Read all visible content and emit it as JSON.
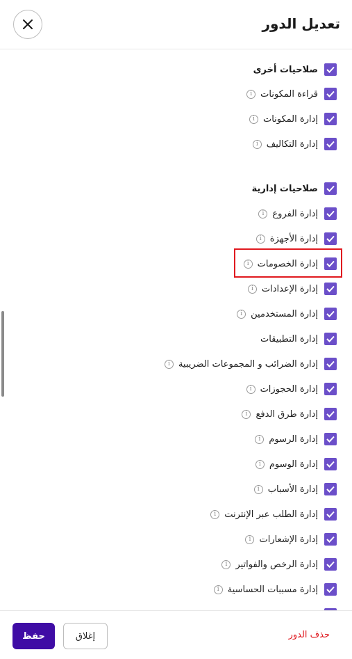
{
  "header": {
    "title": "تعديل الدور",
    "close_icon": "close-icon"
  },
  "groups": [
    {
      "title": "صلاحيات أخرى",
      "checked": true,
      "items": [
        {
          "label": "قراءة المكونات",
          "checked": true,
          "info": true
        },
        {
          "label": "إدارة المكونات",
          "checked": true,
          "info": true
        },
        {
          "label": "إدارة التكاليف",
          "checked": true,
          "info": true
        }
      ]
    },
    {
      "title": "صلاحيات إدارية",
      "checked": true,
      "items": [
        {
          "label": "إدارة الفروع",
          "checked": true,
          "info": true
        },
        {
          "label": "إدارة الأجهزة",
          "checked": true,
          "info": true
        },
        {
          "label": "إدارة الخصومات",
          "checked": true,
          "info": true,
          "highlighted": true
        },
        {
          "label": "إدارة الإعدادات",
          "checked": true,
          "info": true
        },
        {
          "label": "إدارة المستخدمين",
          "checked": true,
          "info": true
        },
        {
          "label": "إدارة التطبيقات",
          "checked": true,
          "info": false
        },
        {
          "label": "إدارة الضرائب و المجموعات الضريبية",
          "checked": true,
          "info": true
        },
        {
          "label": "إدارة الحجوزات",
          "checked": true,
          "info": true
        },
        {
          "label": "إدارة طرق الدفع",
          "checked": true,
          "info": true
        },
        {
          "label": "إدارة الرسوم",
          "checked": true,
          "info": true
        },
        {
          "label": "إدارة الوسوم",
          "checked": true,
          "info": true
        },
        {
          "label": "إدارة الأسباب",
          "checked": true,
          "info": true
        },
        {
          "label": "إدارة الطلب عبر الإنترنت",
          "checked": true,
          "info": true
        },
        {
          "label": "إدارة الإشعارات",
          "checked": true,
          "info": true
        },
        {
          "label": "إدارة الرخص والفواتير",
          "checked": true,
          "info": true
        },
        {
          "label": "إدارة مسببات الحساسية",
          "checked": true,
          "info": true
        }
      ]
    }
  ],
  "footer": {
    "delete_label": "حذف الدور",
    "close_label": "إغلاق",
    "save_label": "حفظ"
  },
  "colors": {
    "checkbox": "#6b4fc9",
    "primary": "#3f0ca5",
    "danger": "#e0191f",
    "highlight": "#e0191f"
  }
}
